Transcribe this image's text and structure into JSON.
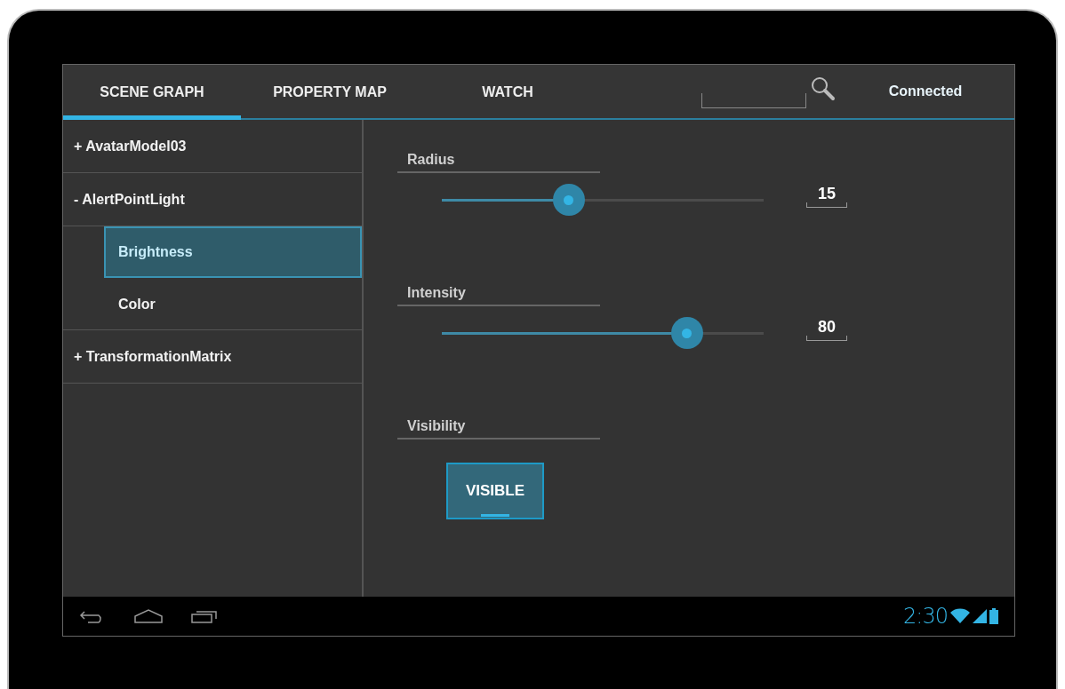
{
  "tabs": [
    {
      "label": "SCENE GRAPH",
      "selected": true
    },
    {
      "label": "PROPERTY MAP",
      "selected": false
    },
    {
      "label": "WATCH",
      "selected": false
    }
  ],
  "status": "Connected",
  "tree": [
    {
      "label": "+ AvatarModel03",
      "selected": false
    },
    {
      "label": "- AlertPointLight",
      "selected": false,
      "children": [
        {
          "label": "Brightness",
          "selected": true
        },
        {
          "label": "Color",
          "selected": false
        }
      ]
    },
    {
      "label": "+ TransformationMatrix",
      "selected": false
    }
  ],
  "properties": [
    {
      "kind": "slider",
      "label": "Radius",
      "level": 0.395,
      "value": "15"
    },
    {
      "kind": "slider",
      "label": "Intensity",
      "level": 0.762,
      "value": "80"
    },
    {
      "kind": "toggle",
      "label": "Visibility",
      "button": "VISIBLE",
      "on": true
    }
  ],
  "nav_bar": {
    "time": "2:30"
  }
}
